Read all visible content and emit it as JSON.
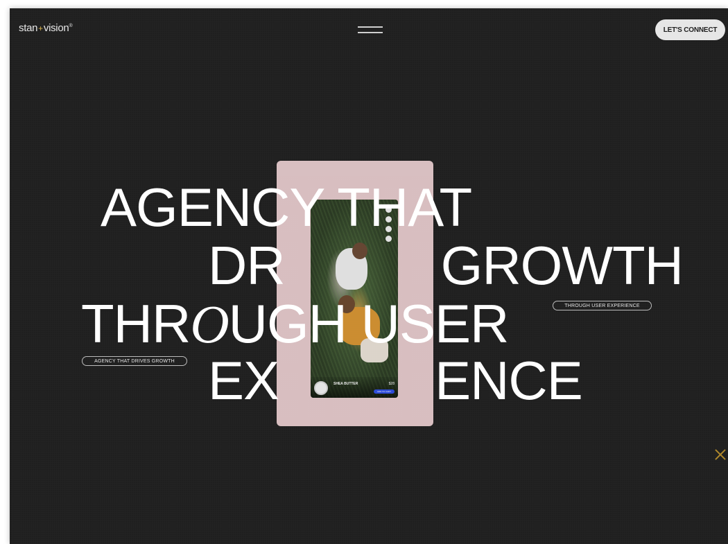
{
  "header": {
    "logo_left": "stan",
    "logo_plus": "+",
    "logo_right": "vision",
    "logo_mark": "®",
    "menu_icon": "hamburger-icon",
    "cta_label": "LET'S CONNECT"
  },
  "hero": {
    "line1": "AGENCY THAT",
    "line2_a": "DR",
    "line2_b": "GROWTH",
    "line3_a": "THR",
    "line3_italic": "O",
    "line3_b": "UGH USER",
    "line4_a": "EX",
    "line4_b": "ENCE",
    "pill_right": "THROUGH USER EXPERIENCE",
    "pill_left": "AGENCY THAT DRIVES GROWTH"
  },
  "phone_card": {
    "product_name": "SHEA BUTTER",
    "price": "$28",
    "button_label": "ADD TO CART",
    "card_color": "#e6cbcd"
  },
  "colors": {
    "background": "#1f1f1f",
    "accent": "#d8b24a",
    "close_icon": "#b0892c"
  },
  "close_icon": "close-x-icon"
}
